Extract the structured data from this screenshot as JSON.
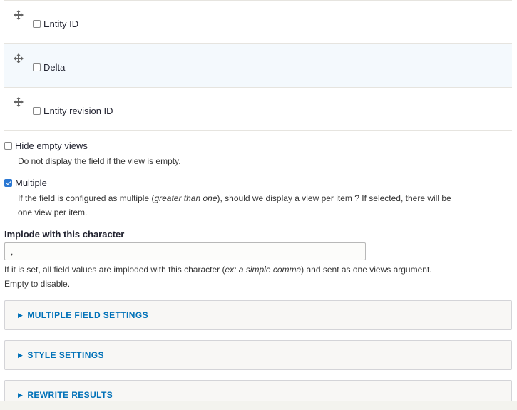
{
  "table_rows": [
    {
      "label": "Entity ID",
      "checked": false
    },
    {
      "label": "Delta",
      "checked": false
    },
    {
      "label": "Entity revision ID",
      "checked": false
    }
  ],
  "hide_empty": {
    "label": "Hide empty views",
    "checked": false,
    "description": "Do not display the field if the view is empty."
  },
  "multiple": {
    "label": "Multiple",
    "checked": true,
    "description_before": "If the field is configured as multiple (",
    "description_em": "greater than one",
    "description_after": "), should we display a view per item ? If selected, there will be",
    "description_line2": "one view per item."
  },
  "implode": {
    "label": "Implode with this character",
    "value": ",",
    "help_before": "If it is set, all field values are imploded with this character (",
    "help_em": "ex: a simple comma",
    "help_after": ") and sent as one views argument.",
    "help_line2": "Empty to disable."
  },
  "sections": [
    {
      "label": "MULTIPLE FIELD SETTINGS"
    },
    {
      "label": "STYLE SETTINGS"
    },
    {
      "label": "REWRITE RESULTS"
    }
  ],
  "colors": {
    "link": "#0071b8",
    "checkbox_checked": "#2b78d3",
    "row_alt": "#f4f9fd"
  },
  "icons": {
    "drag_handle": "move-arrows-icon",
    "section_toggle": "triangle-right-icon"
  }
}
